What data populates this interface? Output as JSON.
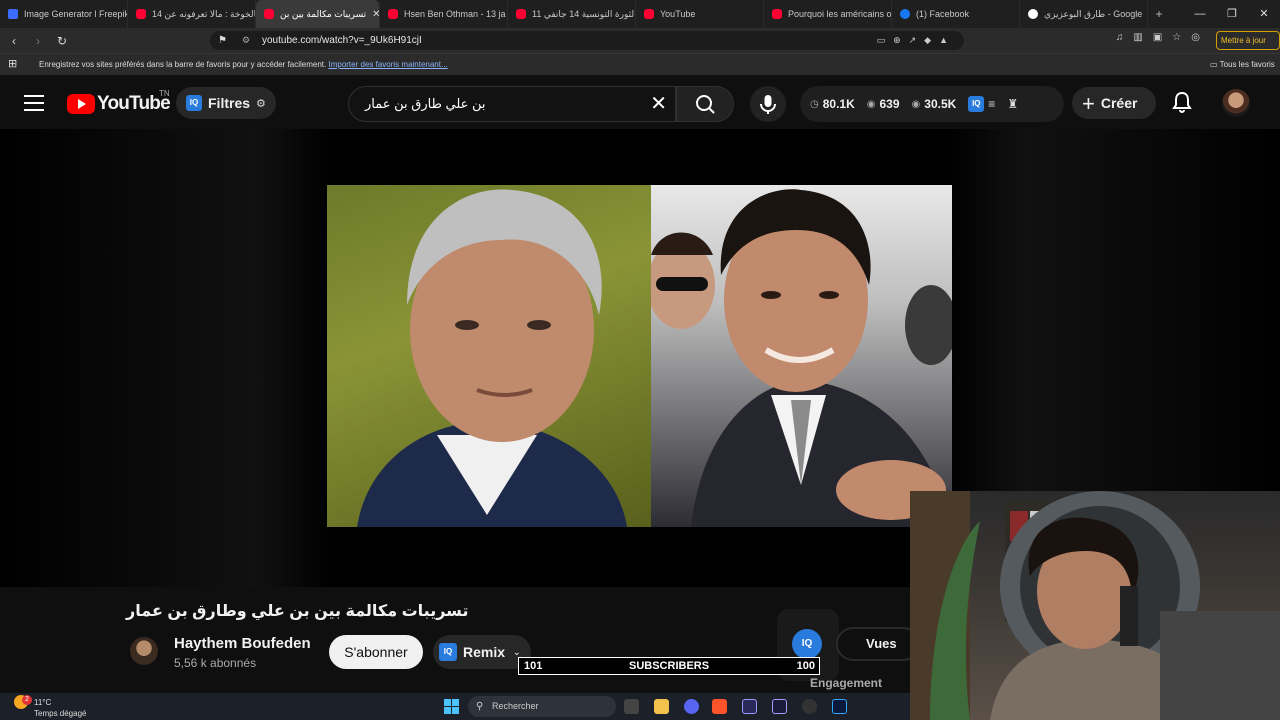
{
  "browser": {
    "tabs": [
      {
        "label": "Image Generator l Freepik",
        "favicon": "freepik-icon"
      },
      {
        "label": "بالخوخة : مالا تعرفونه عن 14",
        "favicon": "youtube-icon"
      },
      {
        "label": "تسريبات مكالمة بين بن",
        "favicon": "youtube-icon",
        "active": true
      },
      {
        "label": "Hsen Ben Othman - 13 ja",
        "favicon": "youtube-icon"
      },
      {
        "label": "الثورة التونسية 14 جانفي 11",
        "favicon": "youtube-icon"
      },
      {
        "label": "YouTube",
        "favicon": "youtube-icon"
      },
      {
        "label": "Pourquoi les américains o",
        "favicon": "youtube-icon"
      },
      {
        "label": "(1) Facebook",
        "favicon": "facebook-icon"
      },
      {
        "label": "طارق البوعزيزي - Google",
        "favicon": "google-icon"
      }
    ],
    "url": "youtube.com/watch?v=_9Uk6H91cjI",
    "update_label": "Mettre à jour",
    "favbar_message": "Enregistrez vos sites préférés dans la barre de favoris pour y accéder facilement.",
    "favbar_link": "Importer des favoris maintenant...",
    "all_favorites": "Tous les favoris"
  },
  "youtube": {
    "logo_text": "YouTube",
    "country_code": "TN",
    "filters_label": "Filtres",
    "search_query": "بن علي طارق بن عمار",
    "stats": [
      {
        "icon": "clock-icon",
        "value": "80.1K"
      },
      {
        "icon": "eye-icon",
        "value": "639"
      },
      {
        "icon": "eye-icon",
        "value": "30.5K"
      }
    ],
    "create_label": "Créer"
  },
  "video": {
    "title": "تسريبات مكالمة بين بن علي وطارق بن عمار",
    "channel_name": "Haythem Boufeden",
    "subscribers": "5,56 k abonnés",
    "subscribe_label": "S'abonner",
    "remix_label": "Remix",
    "iq_label": "IQ",
    "views_label": "Vues",
    "engagement_label": "Engagement"
  },
  "overlay": {
    "left_value": "101",
    "center_label": "SUBSCRIBERS",
    "right_value": "100"
  },
  "taskbar": {
    "weather_temp": "11°C",
    "weather_desc": "Temps dégagé",
    "weather_badge": "2",
    "search_placeholder": "Rechercher"
  },
  "colors": {
    "youtube_red": "#ff0000",
    "iq_blue": "#2a7bde",
    "update_yellow": "#d6a000"
  }
}
